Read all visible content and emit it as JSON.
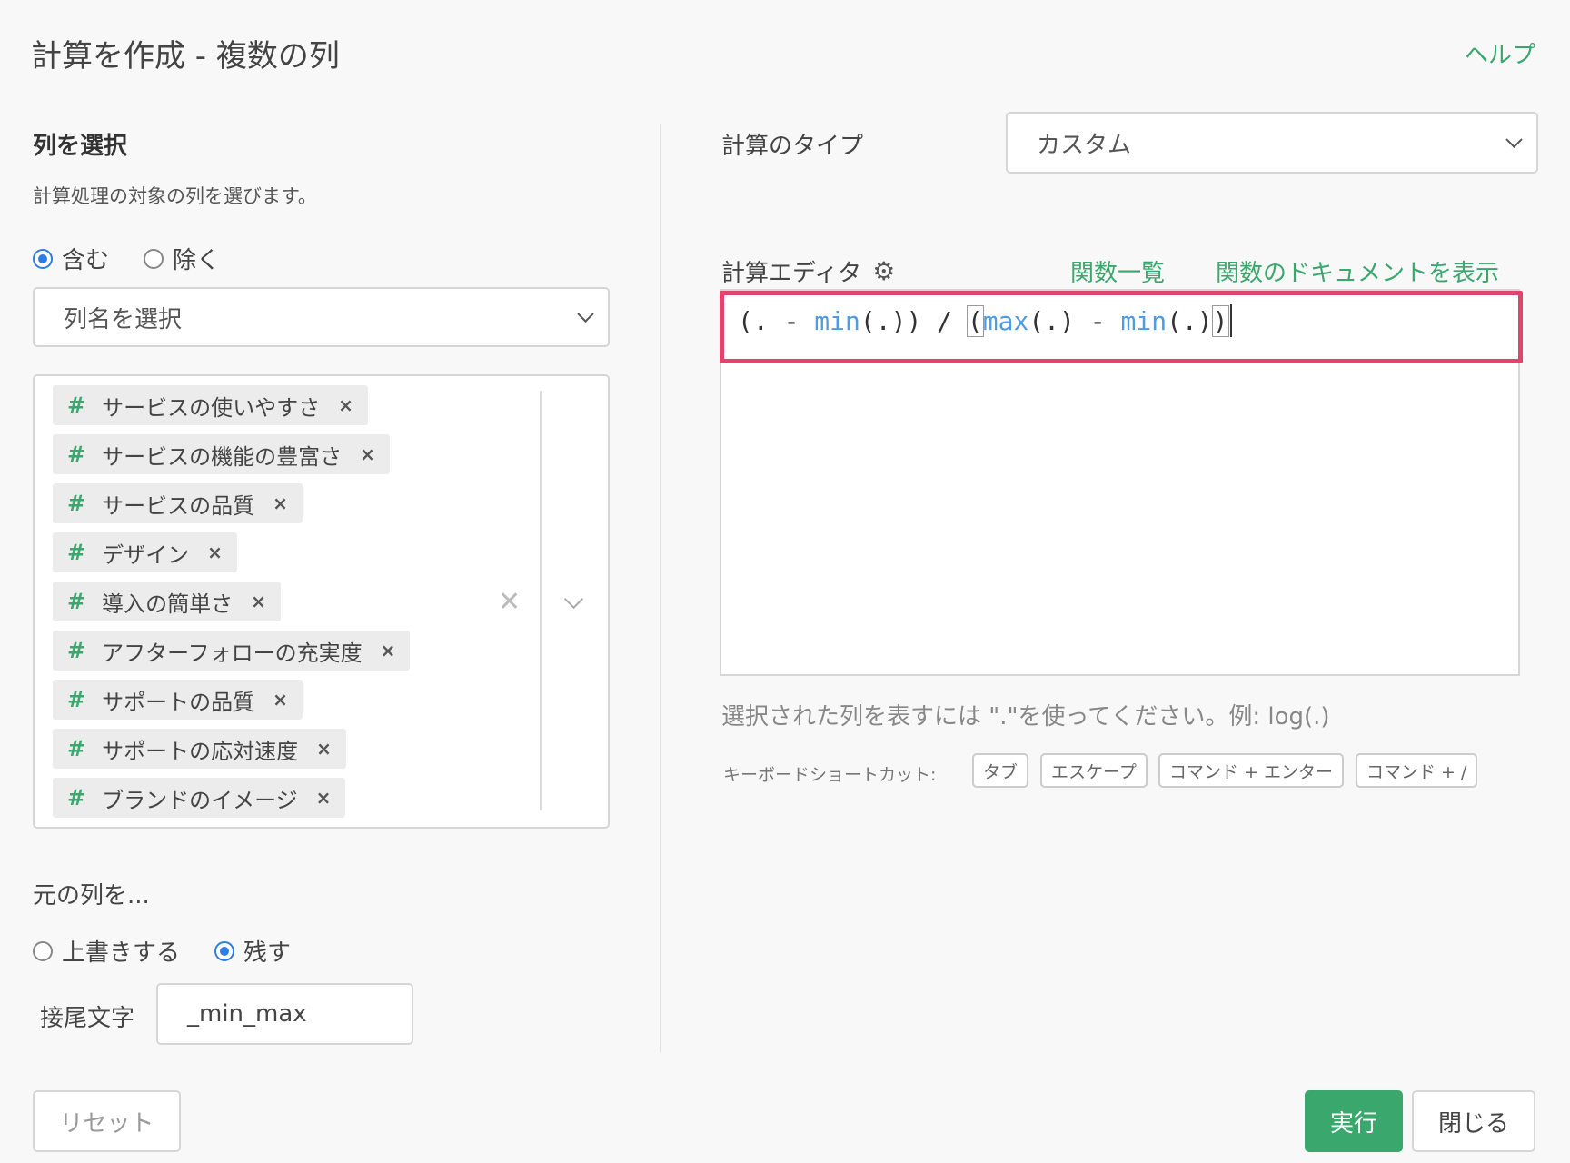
{
  "dialog": {
    "title": "計算を作成 - 複数の列",
    "help_label": "ヘルプ"
  },
  "column_select": {
    "section_title": "列を選択",
    "description": "計算処理の対象の列を選びます。",
    "include_label": "含む",
    "exclude_label": "除く",
    "selected_mode": "include",
    "dropdown_placeholder": "列名を選択",
    "selected_columns": [
      "サービスの使いやすさ",
      "サービスの機能の豊富さ",
      "サービスの品質",
      "デザイン",
      "導入の簡単さ",
      "アフターフォローの充実度",
      "サポートの品質",
      "サポートの応対速度",
      "ブランドのイメージ"
    ],
    "tag_icon": "#",
    "remove_icon": "×"
  },
  "original_column": {
    "title": "元の列を...",
    "overwrite_label": "上書きする",
    "keep_label": "残す",
    "selected_mode": "keep",
    "suffix_label": "接尾文字",
    "suffix_value": "_min_max"
  },
  "calc": {
    "type_label": "計算のタイプ",
    "type_value": "カスタム",
    "editor_label": "計算エディタ",
    "function_list_link": "関数一覧",
    "function_docs_link": "関数のドキュメントを表示",
    "expression": "(. - min(.)) / (max(.) - min(.))",
    "hint": "選択された列を表すには \".\"を使ってください。例: log(.)",
    "shortcut_label": "キーボードショートカット:",
    "shortcuts": [
      "タブ",
      "エスケープ",
      "コマンド + エンター",
      "コマンド + /"
    ]
  },
  "buttons": {
    "reset": "リセット",
    "run": "実行",
    "close": "閉じる"
  },
  "colors": {
    "accent_green": "#3aa76d",
    "radio_blue": "#2f7de1",
    "highlight_pink": "#e0456d",
    "function_blue": "#4e9ce6"
  }
}
